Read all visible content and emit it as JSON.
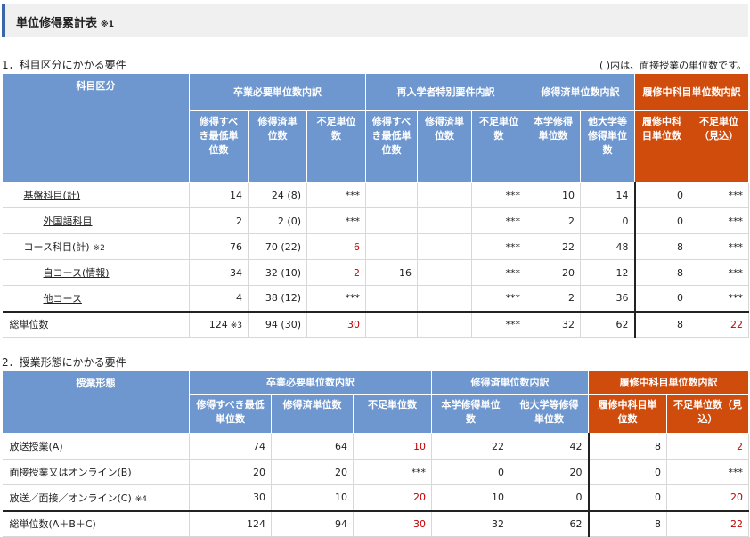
{
  "title": "単位修得累計表",
  "title_note": "※1",
  "s1": {
    "heading": "1．科目区分にかかる要件",
    "note": "( )内は、面接授業の単位数です。",
    "headers": {
      "subject": "科目区分",
      "grad": "卒業必要単位数内訳",
      "reentry": "再入学者特別要件内訳",
      "earned": "修得済単位数内訳",
      "enrolled": "履修中科目単位数内訳",
      "grad_min": "修得すべき最低単位数",
      "grad_earned": "修得済単位数",
      "grad_short": "不足単位数",
      "re_min": "修得すべき最低単位数",
      "re_earned": "修得済単位数",
      "re_short": "不足単位数",
      "own": "本学修得単位数",
      "other": "他大学等修得単位数",
      "enr_units": "履修中科目単位数",
      "enr_short": "不足単位（見込）"
    },
    "rows": [
      {
        "label": "基盤科目(計)",
        "link": true,
        "indent": 1,
        "c1": "14",
        "c2": "24 (8)",
        "c3": "***",
        "c4": "",
        "c5": "",
        "c6": "***",
        "c7": "10",
        "c8": "14",
        "c9": "0",
        "c10": "***"
      },
      {
        "label": "外国語科目",
        "link": true,
        "indent": 2,
        "c1": "2",
        "c2": "2 (0)",
        "c3": "***",
        "c4": "",
        "c5": "",
        "c6": "***",
        "c7": "2",
        "c8": "0",
        "c9": "0",
        "c10": "***"
      },
      {
        "label": "コース科目(計)",
        "note": "※2",
        "link": false,
        "indent": 1,
        "c1": "76",
        "c2": "70 (22)",
        "c3": "6",
        "c4": "",
        "c5": "",
        "c6": "***",
        "c7": "22",
        "c8": "48",
        "c9": "8",
        "c10": "***"
      },
      {
        "label": "自コース(情報)",
        "link": true,
        "indent": 2,
        "c1": "34",
        "c2": "32 (10)",
        "c3": "2",
        "c4": "16",
        "c5": "",
        "c6": "***",
        "c7": "20",
        "c8": "12",
        "c9": "8",
        "c10": "***"
      },
      {
        "label": "他コース",
        "link": true,
        "indent": 2,
        "c1": "4",
        "c2": "38 (12)",
        "c3": "***",
        "c4": "",
        "c5": "",
        "c6": "***",
        "c7": "2",
        "c8": "36",
        "c9": "0",
        "c10": "***"
      }
    ],
    "total": {
      "label": "総単位数",
      "c1": "124",
      "c1note": "※3",
      "c2": "94 (30)",
      "c3": "30",
      "c4": "",
      "c5": "",
      "c6": "***",
      "c7": "32",
      "c8": "62",
      "c9": "8",
      "c10": "22"
    }
  },
  "s2": {
    "heading": "2．授業形態にかかる要件",
    "headers": {
      "form": "授業形態",
      "grad": "卒業必要単位数内訳",
      "earned": "修得済単位数内訳",
      "enrolled": "履修中科目単位数内訳",
      "grad_min": "修得すべき最低単位数",
      "grad_earned": "修得済単位数",
      "grad_short": "不足単位数",
      "own": "本学修得単位数",
      "other": "他大学等修得単位数",
      "enr_units": "履修中科目単位数",
      "enr_short": "不足単位数（見込）"
    },
    "rows": [
      {
        "label": "放送授業(A)",
        "c1": "74",
        "c2": "64",
        "c3": "10",
        "c4": "22",
        "c5": "42",
        "c6": "8",
        "c7": "2"
      },
      {
        "label": "面接授業又はオンライン(B)",
        "c1": "20",
        "c2": "20",
        "c3": "***",
        "c4": "0",
        "c5": "20",
        "c6": "0",
        "c7": "***"
      },
      {
        "label": "放送／面接／オンライン(C)",
        "note": "※4",
        "c1": "30",
        "c2": "10",
        "c3": "20",
        "c4": "10",
        "c5": "0",
        "c6": "0",
        "c7": "20"
      }
    ],
    "total": {
      "label": "総単位数(A＋B＋C)",
      "c1": "124",
      "c2": "94",
      "c3": "30",
      "c4": "32",
      "c5": "62",
      "c6": "8",
      "c7": "22"
    }
  }
}
